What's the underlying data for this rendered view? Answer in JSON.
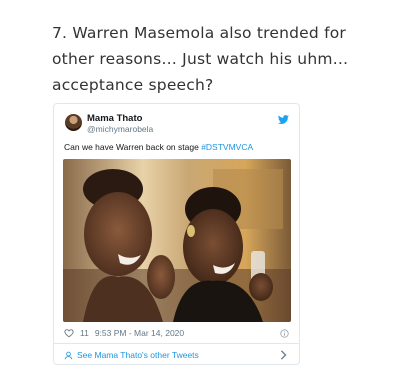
{
  "article": {
    "heading": "7. Warren Masemola also trended for other reasons… Just watch his uhm… acceptance speech?"
  },
  "tweet": {
    "author_name": "Mama Thato",
    "author_handle": "@michymarobela",
    "text": "Can we have Warren back on stage ",
    "hashtag": "#DSTVMVCA",
    "likes": "11",
    "timestamp": "9:53 PM - Mar 14, 2020",
    "see_more": "See Mama Thato's other Tweets"
  },
  "colors": {
    "link": "#1b95e0",
    "muted": "#657786",
    "border": "#e1e8ed"
  },
  "icons": {
    "bird": "twitter-bird-icon",
    "heart": "heart-icon",
    "info": "info-icon",
    "person": "person-icon",
    "chevron": "chevron-right-icon"
  }
}
